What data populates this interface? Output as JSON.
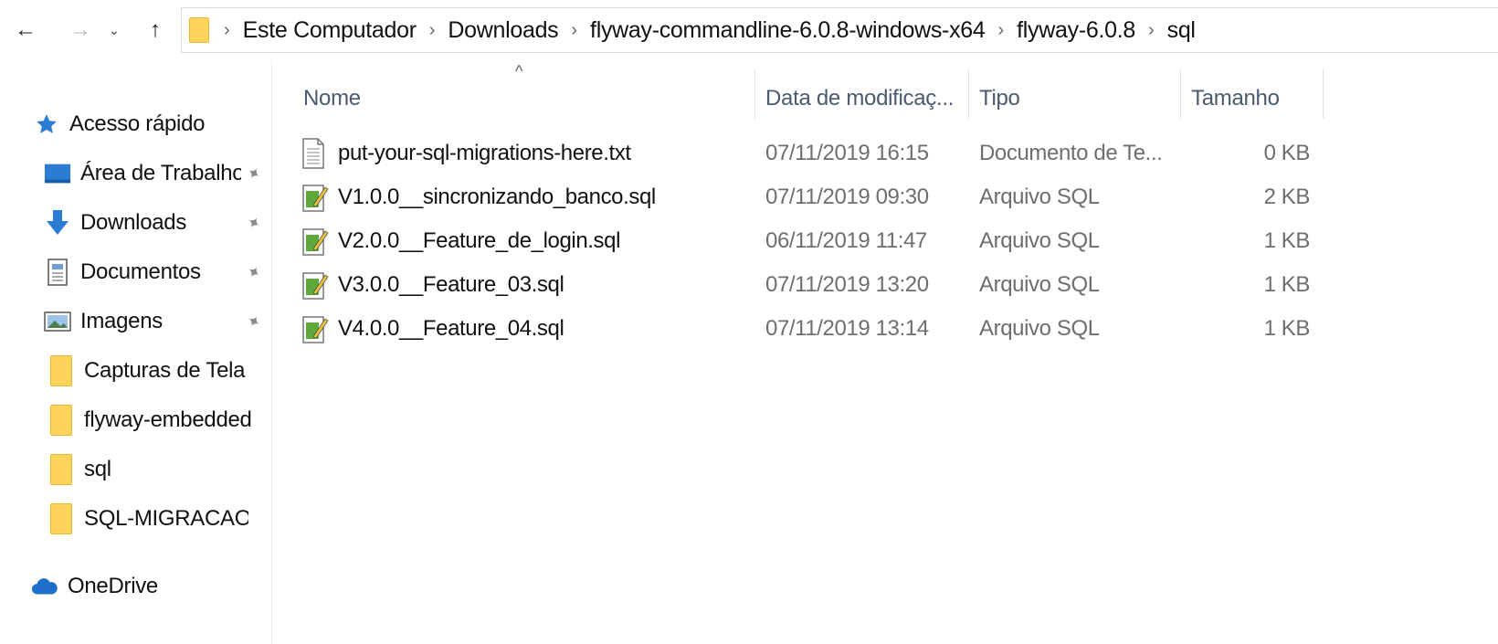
{
  "nav": {
    "back": "←",
    "forward": "→",
    "recent": "⌄",
    "up": "↑"
  },
  "address": {
    "separator": "›",
    "crumbs": [
      "Este Computador",
      "Downloads",
      "flyway-commandline-6.0.8-windows-x64",
      "flyway-6.0.8",
      "sql"
    ]
  },
  "sidebar": {
    "quick_access": "Acesso rápido",
    "items": [
      {
        "label": "Área de Trabalho",
        "icon": "desktop-icon",
        "pinned": true
      },
      {
        "label": "Downloads",
        "icon": "download-arrow-icon",
        "pinned": true
      },
      {
        "label": "Documentos",
        "icon": "documents-icon",
        "pinned": true
      },
      {
        "label": "Imagens",
        "icon": "pictures-icon",
        "pinned": true
      },
      {
        "label": "Capturas de Tela",
        "icon": "folder-icon",
        "pinned": false
      },
      {
        "label": "flyway-embedded",
        "icon": "folder-icon",
        "pinned": false
      },
      {
        "label": "sql",
        "icon": "folder-icon",
        "pinned": false
      },
      {
        "label": "SQL-MIGRACAO",
        "icon": "folder-icon",
        "pinned": false
      }
    ],
    "onedrive": "OneDrive"
  },
  "columns": {
    "name": "Nome",
    "date": "Data de modificaç...",
    "type": "Tipo",
    "size": "Tamanho",
    "sort_indicator": "^"
  },
  "files": [
    {
      "name": "put-your-sql-migrations-here.txt",
      "date": "07/11/2019 16:15",
      "type": "Documento de Te...",
      "size": "0 KB",
      "icon": "text-file-icon"
    },
    {
      "name": "V1.0.0__sincronizando_banco.sql",
      "date": "07/11/2019 09:30",
      "type": "Arquivo SQL",
      "size": "2 KB",
      "icon": "sql-file-icon"
    },
    {
      "name": "V2.0.0__Feature_de_login.sql",
      "date": "06/11/2019 11:47",
      "type": "Arquivo SQL",
      "size": "1 KB",
      "icon": "sql-file-icon"
    },
    {
      "name": "V3.0.0__Feature_03.sql",
      "date": "07/11/2019 13:20",
      "type": "Arquivo SQL",
      "size": "1 KB",
      "icon": "sql-file-icon"
    },
    {
      "name": "V4.0.0__Feature_04.sql",
      "date": "07/11/2019 13:14",
      "type": "Arquivo SQL",
      "size": "1 KB",
      "icon": "sql-file-icon"
    }
  ],
  "colors": {
    "folder": "#ffd35c",
    "header_text": "#4b5a6e",
    "accent_blue": "#2b7cd3"
  }
}
